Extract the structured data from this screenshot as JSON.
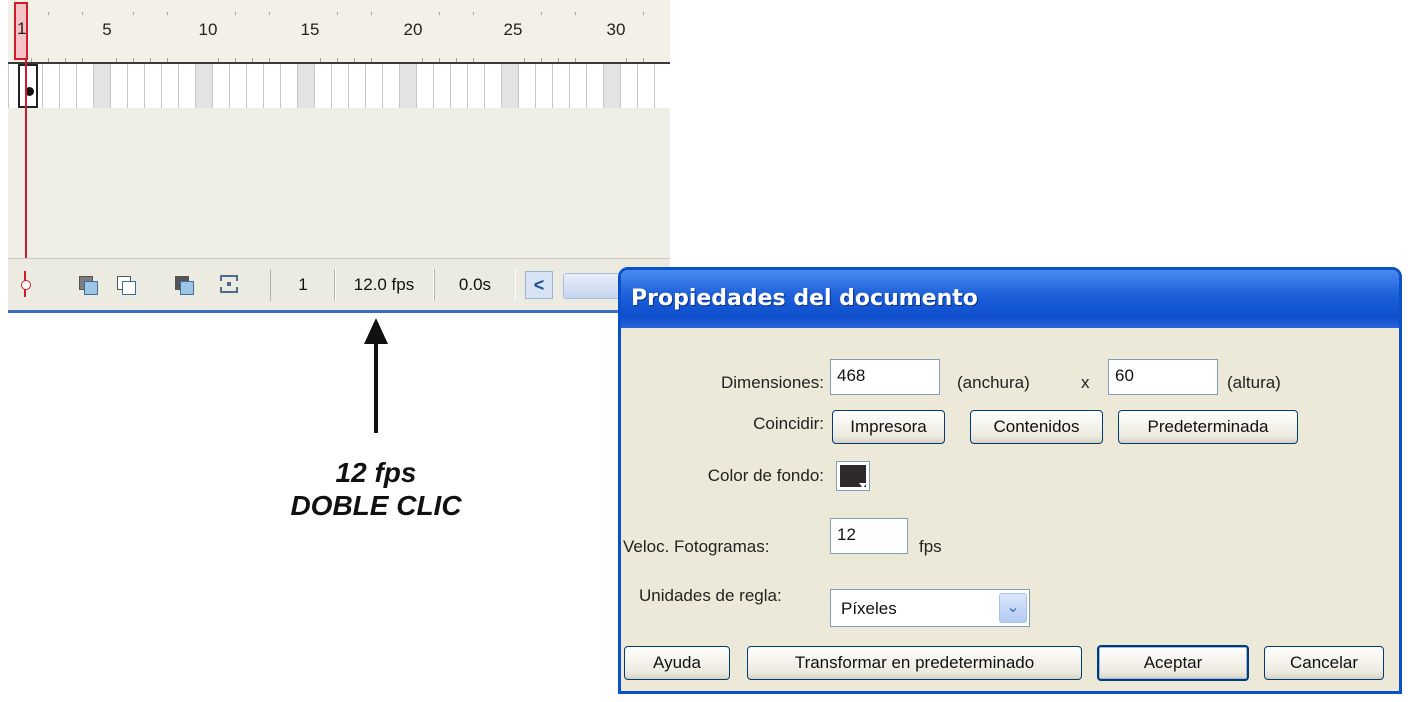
{
  "timeline": {
    "ruler_numbers": [
      "1",
      "5",
      "10",
      "15",
      "20",
      "25",
      "30"
    ],
    "current_frame": "1",
    "frame_rate": "12.0 fps",
    "elapsed_time": "0.0s"
  },
  "annotation": {
    "line1": "12 fps",
    "line2": "DOBLE CLIC"
  },
  "dialog": {
    "title": "Propiedades del documento",
    "dimensions_label": "Dimensiones:",
    "width_value": "468",
    "width_unit": "(anchura)",
    "times": "x",
    "height_value": "60",
    "height_unit": "(altura)",
    "match_label": "Coincidir:",
    "match_printer": "Impresora",
    "match_contents": "Contenidos",
    "match_default": "Predeterminada",
    "bg_color_label": "Color de fondo:",
    "bg_color": "#2e2a2a",
    "frame_rate_label": "Veloc. Fotogramas:",
    "frame_rate_value": "12",
    "frame_rate_unit": "fps",
    "ruler_units_label": "Unidades de regla:",
    "ruler_units_value": "Píxeles",
    "help_button": "Ayuda",
    "make_default_button": "Transformar en predeterminado",
    "ok_button": "Aceptar",
    "cancel_button": "Cancelar"
  }
}
